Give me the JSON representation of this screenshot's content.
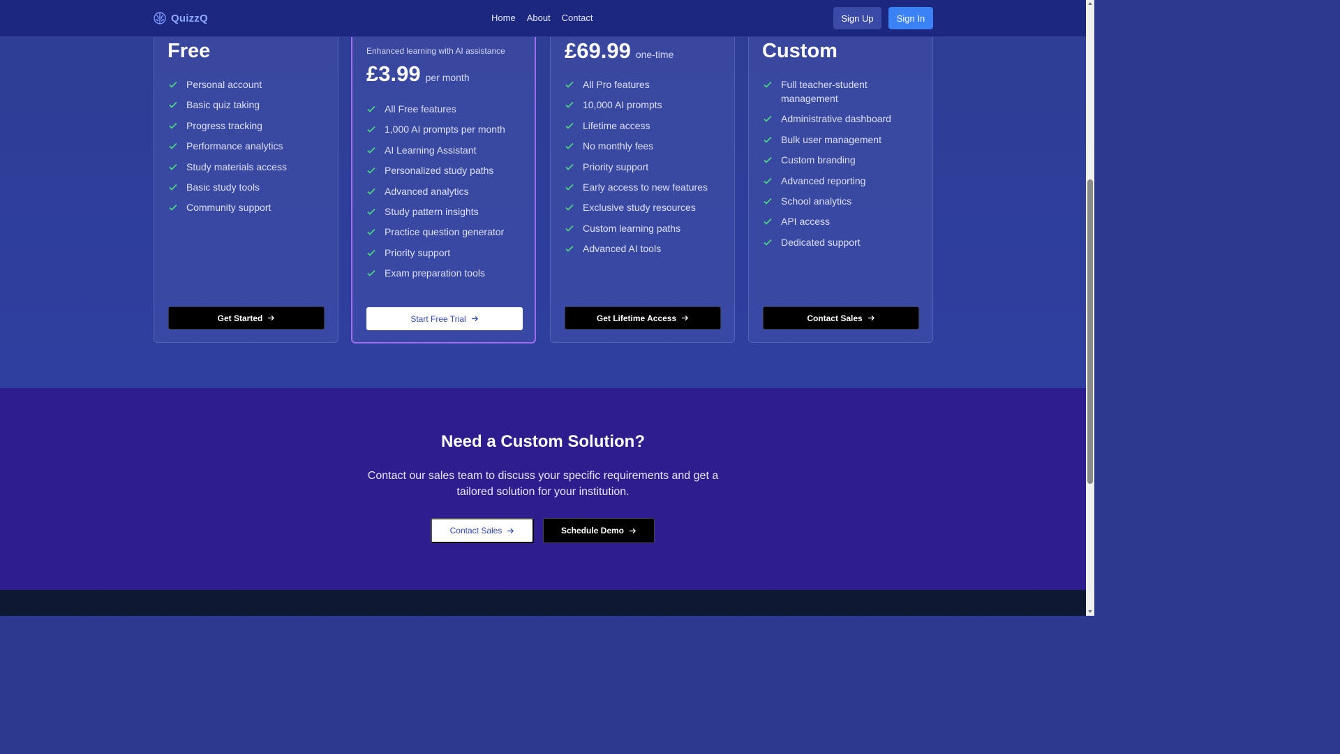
{
  "header": {
    "logo_text": "QuizzQ",
    "nav": [
      "Home",
      "About",
      "Contact"
    ],
    "signup_label": "Sign Up",
    "signin_label": "Sign In"
  },
  "plans": [
    {
      "title": "Free",
      "features": [
        "Personal account",
        "Basic quiz taking",
        "Progress tracking",
        "Performance analytics",
        "Study materials access",
        "Basic study tools",
        "Community support"
      ],
      "button": "Get Started"
    },
    {
      "subtitle": "Enhanced learning with AI assistance",
      "price": "£3.99",
      "period": "per month",
      "features": [
        "All Free features",
        "1,000 AI prompts per month",
        "AI Learning Assistant",
        "Personalized study paths",
        "Advanced analytics",
        "Study pattern insights",
        "Practice question generator",
        "Priority support",
        "Exam preparation tools"
      ],
      "button": "Start Free Trial"
    },
    {
      "price": "£69.99",
      "period": "one-time",
      "features": [
        "All Pro features",
        "10,000 AI prompts",
        "Lifetime access",
        "No monthly fees",
        "Priority support",
        "Early access to new features",
        "Exclusive study resources",
        "Custom learning paths",
        "Advanced AI tools"
      ],
      "button": "Get Lifetime Access"
    },
    {
      "title": "Custom",
      "features": [
        "Full teacher-student management",
        "Administrative dashboard",
        "Bulk user management",
        "Custom branding",
        "Advanced reporting",
        "School analytics",
        "API access",
        "Dedicated support"
      ],
      "button": "Contact Sales"
    }
  ],
  "cta": {
    "title": "Need a Custom Solution?",
    "text": "Contact our sales team to discuss your specific requirements and get a tailored solution for your institution.",
    "primary_button": "Contact Sales",
    "secondary_button": "Schedule Demo"
  },
  "colors": {
    "accent": "#3b82f6",
    "featured_border": "#a06cf0",
    "check": "#4ade80"
  }
}
